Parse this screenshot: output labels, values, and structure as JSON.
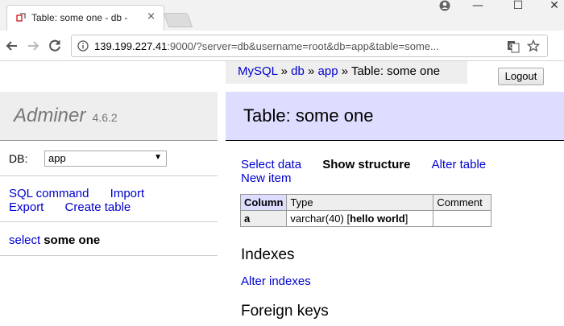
{
  "browser": {
    "tab_title": "Table: some one - db -",
    "tab_close": "×",
    "window_controls": {
      "minimize": "—",
      "maximize": "☐",
      "close": "✕"
    },
    "url_host": "139.199.227.41",
    "url_rest": ":9000/?server=db&username=root&db=app&table=some..."
  },
  "adminer": {
    "breadcrumb": {
      "mysql": "MySQL",
      "sep": "»",
      "db": "db",
      "app": "app",
      "current": "Table: some one"
    },
    "logout_label": "Logout",
    "sidebar": {
      "app_name": "Adminer",
      "version": "4.6.2",
      "db_label": "DB:",
      "db_selected": "app",
      "links": {
        "sql_command": "SQL command",
        "import": "Import",
        "export": "Export",
        "create_table": "Create table"
      },
      "table_select_label": "select",
      "table_name": "some one"
    },
    "main": {
      "title": "Table: some one",
      "actions": {
        "select_data": "Select data",
        "show_structure": "Show structure",
        "alter_table": "Alter table",
        "new_item": "New item"
      },
      "table": {
        "headers": {
          "column": "Column",
          "type": "Type",
          "comment": "Comment"
        },
        "rows": [
          {
            "column": "a",
            "type": "varchar(40)",
            "default_open": "[",
            "default": "hello world",
            "default_close": "]",
            "comment": ""
          }
        ]
      },
      "indexes_heading": "Indexes",
      "alter_indexes": "Alter indexes",
      "foreign_keys_heading": "Foreign keys"
    }
  }
}
